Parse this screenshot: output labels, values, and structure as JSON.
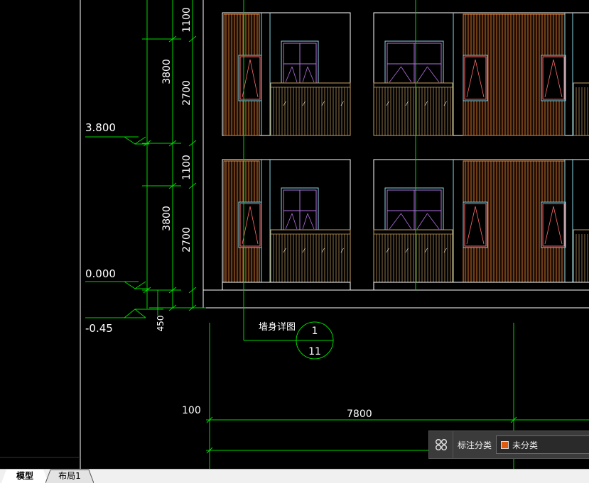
{
  "drawing": {
    "elevation_labels": [
      {
        "name": "elevation-3800",
        "text": "3.800"
      },
      {
        "name": "elevation-0000",
        "text": "0.000"
      },
      {
        "name": "elevation-minus045",
        "text": "-0.45"
      }
    ],
    "vertical_dimensions": {
      "upper_total": "3800",
      "upper_top": "1100",
      "upper_bottom": "2700",
      "lower_total": "3800",
      "lower_top": "1100",
      "lower_bottom": "2700",
      "plinth": "450"
    },
    "detail_callout": {
      "label": "墙身详图",
      "number": "1",
      "sheet": "11"
    },
    "horizontal_dimensions": {
      "offset": "100",
      "span": "7800"
    }
  },
  "annotation_bar": {
    "label": "标注分类",
    "selected_value": "未分类",
    "swatch_color": "#e05a10",
    "icon": "grid-icon"
  },
  "layout_tabs": [
    {
      "label": "模型",
      "active": true
    },
    {
      "label": "布局1",
      "active": false
    }
  ],
  "colors": {
    "dimension": "#00d800",
    "outline": "#ffffff",
    "cladding": "#e8843a",
    "cladding_fill": "#1a0c03",
    "window_frame": "#8ad6e6",
    "window_sash": "#b070e0",
    "railing": "#c9a060",
    "column_line": "#8ad6e6",
    "background": "#000000"
  }
}
